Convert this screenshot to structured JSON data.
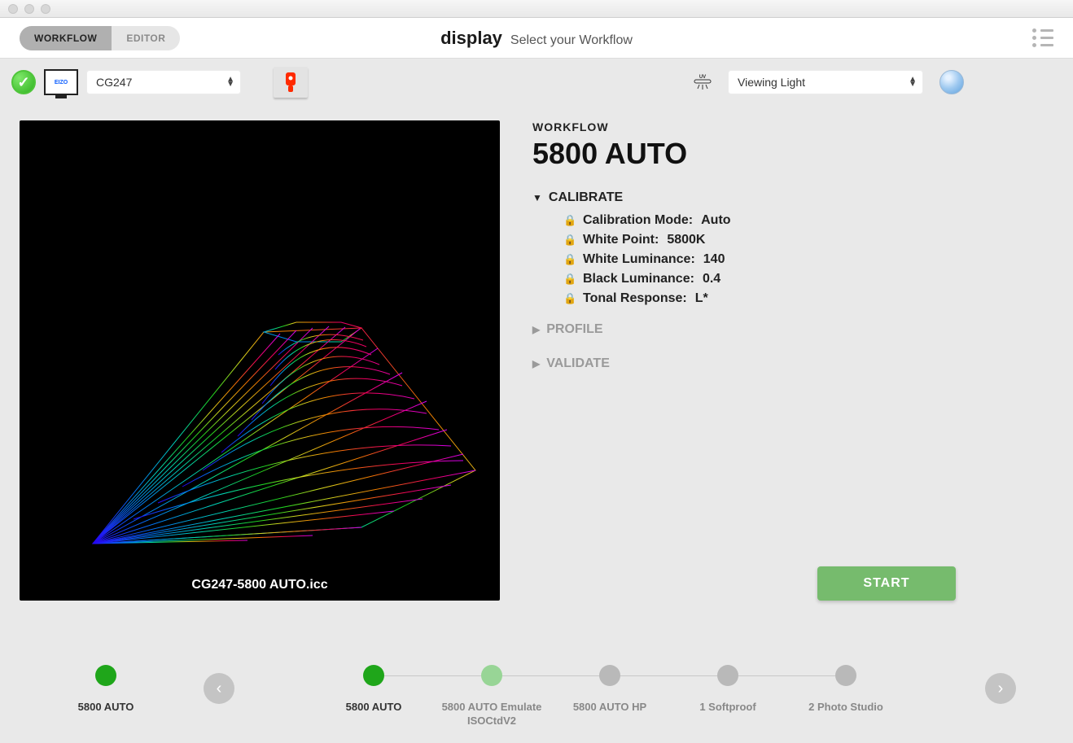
{
  "header": {
    "tabs": [
      "WORKFLOW",
      "EDITOR"
    ],
    "active_tab": 0,
    "title": "display",
    "subtitle": "Select your Workflow"
  },
  "toolbar": {
    "monitor_brand": "EIZO",
    "monitor_select": "CG247",
    "viewing_label": "Viewing Light",
    "uv_label": "UV"
  },
  "gamut": {
    "caption": "CG247-5800 AUTO.icc"
  },
  "workflow": {
    "label": "WORKFLOW",
    "name": "5800 AUTO",
    "sections": {
      "calibrate": {
        "title": "CALIBRATE",
        "params": [
          {
            "label": "Calibration Mode:",
            "value": "Auto"
          },
          {
            "label": "White Point:",
            "value": "5800K"
          },
          {
            "label": "White Luminance:",
            "value": "140"
          },
          {
            "label": "Black Luminance:",
            "value": "0.4"
          },
          {
            "label": "Tonal Response:",
            "value": "L*"
          }
        ]
      },
      "profile": {
        "title": "PROFILE"
      },
      "validate": {
        "title": "VALIDATE"
      }
    },
    "start_label": "START"
  },
  "stepper": {
    "prev": "5800 AUTO",
    "steps": [
      {
        "label": "5800 AUTO",
        "state": "active"
      },
      {
        "label": "5800 AUTO Emulate ISOCtdV2",
        "state": "soft"
      },
      {
        "label": "5800 AUTO HP",
        "state": "idle"
      },
      {
        "label": "1 Softproof",
        "state": "idle"
      },
      {
        "label": "2 Photo Studio",
        "state": "idle"
      }
    ]
  }
}
